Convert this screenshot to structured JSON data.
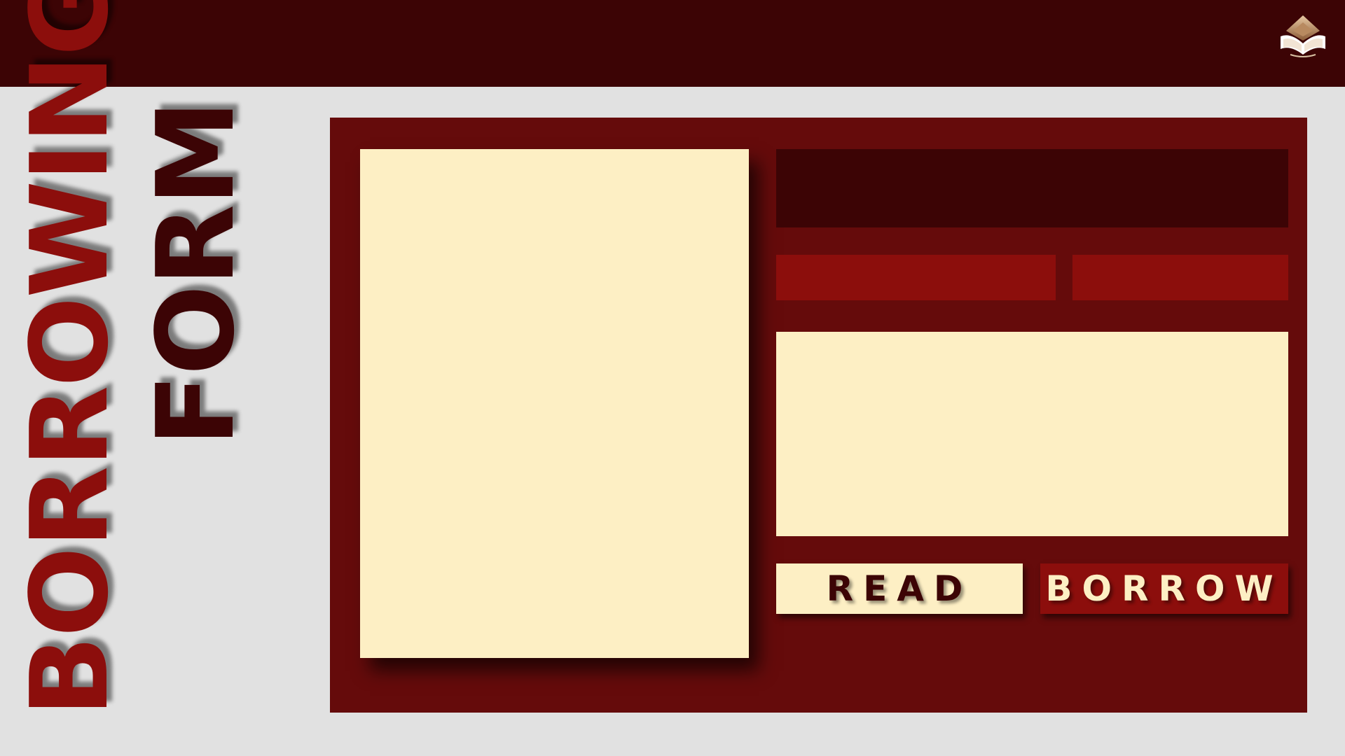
{
  "header": {
    "logo_icon": "open-book-logo-icon"
  },
  "side_title": {
    "line1": "BORROWING",
    "line2": "FORM"
  },
  "form": {
    "read_label": "READ",
    "borrow_label": "BORROW"
  },
  "colors": {
    "dark_maroon": "#3c0405",
    "panel_maroon": "#650b0b",
    "accent_red": "#8c0e0c",
    "cream": "#fdefc4",
    "background_gray": "#e1e1e1"
  }
}
